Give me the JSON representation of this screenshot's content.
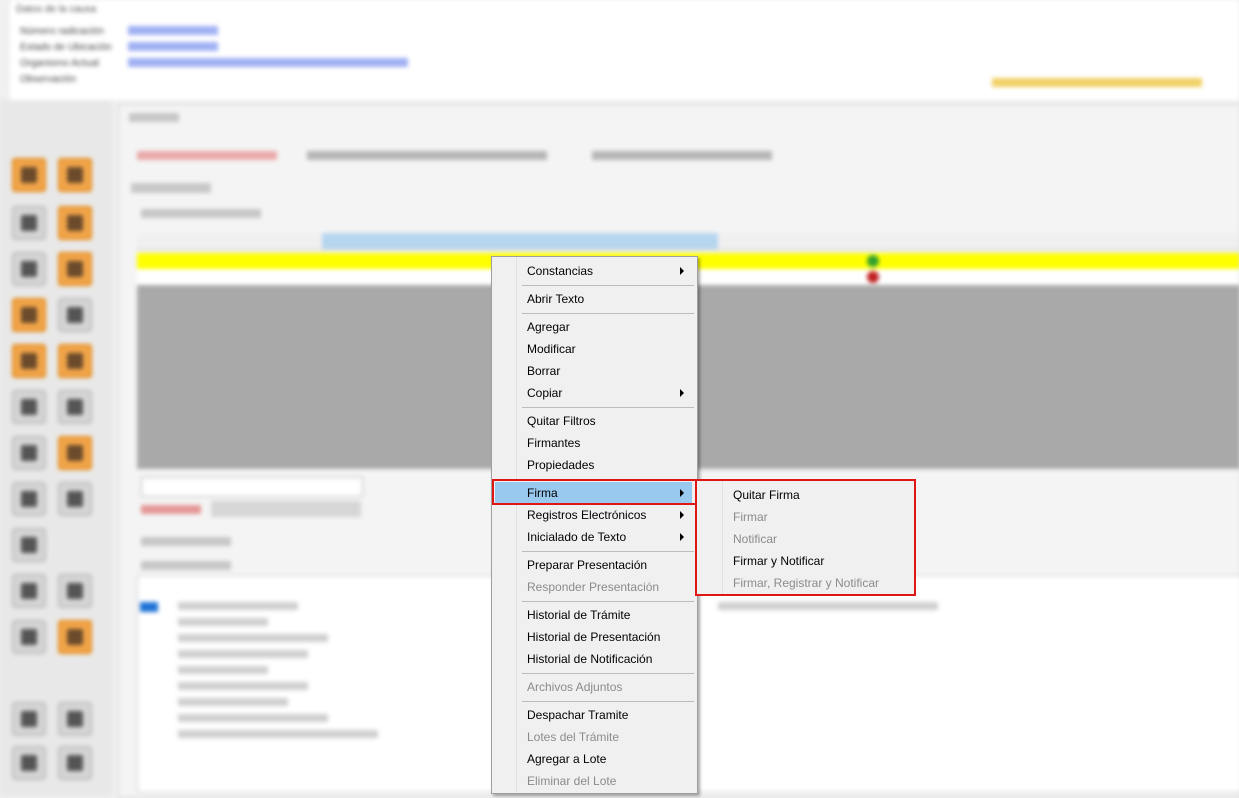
{
  "context_menu": {
    "items": [
      {
        "label": "Constancias",
        "has_submenu": true,
        "enabled": true
      },
      {
        "label": "Abrir Texto",
        "enabled": true
      },
      {
        "label": "Agregar",
        "enabled": true
      },
      {
        "label": "Modificar",
        "enabled": true
      },
      {
        "label": "Borrar",
        "enabled": true
      },
      {
        "label": "Copiar",
        "has_submenu": true,
        "enabled": true
      },
      {
        "label": "Quitar Filtros",
        "enabled": true
      },
      {
        "label": "Firmantes",
        "enabled": true
      },
      {
        "label": "Propiedades",
        "enabled": true
      },
      {
        "label": "Firma",
        "has_submenu": true,
        "enabled": true,
        "selected": true
      },
      {
        "label": "Registros Electrónicos",
        "has_submenu": true,
        "enabled": true
      },
      {
        "label": "Inicialado de Texto",
        "has_submenu": true,
        "enabled": true
      },
      {
        "label": "Preparar Presentación",
        "enabled": true
      },
      {
        "label": "Responder Presentación",
        "enabled": false
      },
      {
        "label": "Historial de Trámite",
        "enabled": true
      },
      {
        "label": "Historial de Presentación",
        "enabled": true
      },
      {
        "label": "Historial de Notificación",
        "enabled": true
      },
      {
        "label": "Archivos Adjuntos",
        "enabled": false
      },
      {
        "label": "Despachar Tramite",
        "enabled": true
      },
      {
        "label": "Lotes del Trámite",
        "enabled": false
      },
      {
        "label": "Agregar a Lote",
        "enabled": true
      },
      {
        "label": "Eliminar del Lote",
        "enabled": false
      }
    ]
  },
  "firma_submenu": {
    "items": [
      {
        "label": "Quitar Firma",
        "enabled": true
      },
      {
        "label": "Firmar",
        "enabled": false
      },
      {
        "label": "Notificar",
        "enabled": false
      },
      {
        "label": "Firmar y Notificar",
        "enabled": true
      },
      {
        "label": "Firmar, Registrar y Notificar",
        "enabled": false
      }
    ]
  },
  "colors": {
    "highlight": "#99c9ef",
    "annotation_border": "#e01515",
    "row_highlight": "#ffff00"
  }
}
